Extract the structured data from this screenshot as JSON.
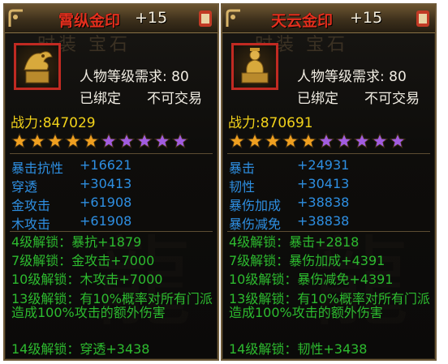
{
  "items": [
    {
      "name": "霄纵金印",
      "level": "+15",
      "requirement": "人物等级需求: 80",
      "bound": "已绑定",
      "tradable": "不可交易",
      "power": "战力:847029",
      "stars": {
        "gold": 5,
        "purple": 5
      },
      "attributes": [
        {
          "label": "暴击抗性",
          "value": "+16621"
        },
        {
          "label": "穿透",
          "value": "+30413"
        },
        {
          "label": "金攻击",
          "value": "+61908"
        },
        {
          "label": "木攻击",
          "value": "+61908"
        }
      ],
      "unlocks": [
        "4级解锁：暴抗+1879",
        "7级解锁：金攻击+7000",
        "10级解锁：木攻击+7000",
        "13级解锁：有10%概率对所有门派造成100%攻击的额外伤害",
        "14级解锁：穿透+3438"
      ]
    },
    {
      "name": "天云金印",
      "level": "+15",
      "requirement": "人物等级需求: 80",
      "bound": "已绑定",
      "tradable": "不可交易",
      "power": "战力:870691",
      "stars": {
        "gold": 5,
        "purple": 5
      },
      "attributes": [
        {
          "label": "暴击",
          "value": "+24931"
        },
        {
          "label": "韧性",
          "value": "+30413"
        },
        {
          "label": "暴伤加成",
          "value": "+38838"
        },
        {
          "label": "暴伤减免",
          "value": "+38838"
        }
      ],
      "unlocks": [
        "4级解锁：暴击+2818",
        "7级解锁：暴伤加成+4391",
        "10级解锁：暴伤减免+4391",
        "13级解锁：有10%概率对所有门派造成100%攻击的额外伤害",
        "14级解锁：韧性+3438"
      ]
    }
  ],
  "colors": {
    "title": "#e32f1d",
    "power": "#f2d21a",
    "attribute": "#2e8fe2",
    "unlock": "#2dbb2f",
    "star_gold": "#f0a020",
    "star_purple": "#a25ce0"
  },
  "icons": [
    "phoenix-seal-icon",
    "figure-seal-icon",
    "gold-star-icon",
    "purple-star-icon"
  ]
}
